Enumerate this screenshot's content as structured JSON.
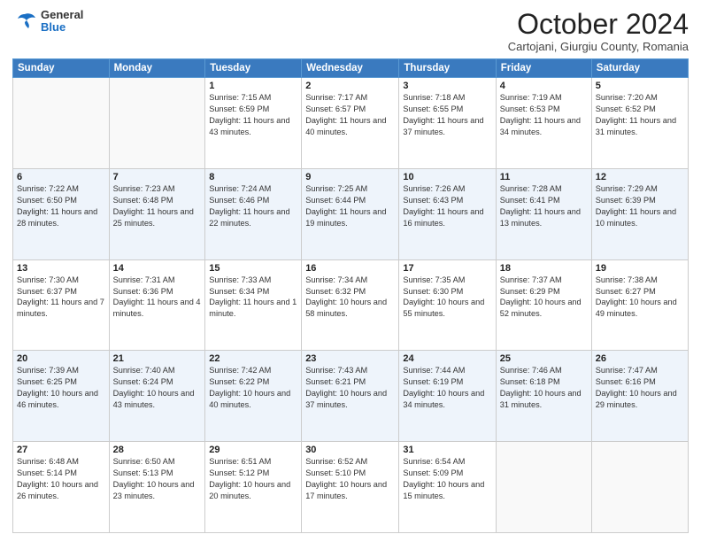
{
  "header": {
    "logo": {
      "general": "General",
      "blue": "Blue"
    },
    "title": "October 2024",
    "subtitle": "Cartojani, Giurgiu County, Romania"
  },
  "days_of_week": [
    "Sunday",
    "Monday",
    "Tuesday",
    "Wednesday",
    "Thursday",
    "Friday",
    "Saturday"
  ],
  "weeks": [
    [
      {
        "day": "",
        "info": ""
      },
      {
        "day": "",
        "info": ""
      },
      {
        "day": "1",
        "info": "Sunrise: 7:15 AM\nSunset: 6:59 PM\nDaylight: 11 hours and 43 minutes."
      },
      {
        "day": "2",
        "info": "Sunrise: 7:17 AM\nSunset: 6:57 PM\nDaylight: 11 hours and 40 minutes."
      },
      {
        "day": "3",
        "info": "Sunrise: 7:18 AM\nSunset: 6:55 PM\nDaylight: 11 hours and 37 minutes."
      },
      {
        "day": "4",
        "info": "Sunrise: 7:19 AM\nSunset: 6:53 PM\nDaylight: 11 hours and 34 minutes."
      },
      {
        "day": "5",
        "info": "Sunrise: 7:20 AM\nSunset: 6:52 PM\nDaylight: 11 hours and 31 minutes."
      }
    ],
    [
      {
        "day": "6",
        "info": "Sunrise: 7:22 AM\nSunset: 6:50 PM\nDaylight: 11 hours and 28 minutes."
      },
      {
        "day": "7",
        "info": "Sunrise: 7:23 AM\nSunset: 6:48 PM\nDaylight: 11 hours and 25 minutes."
      },
      {
        "day": "8",
        "info": "Sunrise: 7:24 AM\nSunset: 6:46 PM\nDaylight: 11 hours and 22 minutes."
      },
      {
        "day": "9",
        "info": "Sunrise: 7:25 AM\nSunset: 6:44 PM\nDaylight: 11 hours and 19 minutes."
      },
      {
        "day": "10",
        "info": "Sunrise: 7:26 AM\nSunset: 6:43 PM\nDaylight: 11 hours and 16 minutes."
      },
      {
        "day": "11",
        "info": "Sunrise: 7:28 AM\nSunset: 6:41 PM\nDaylight: 11 hours and 13 minutes."
      },
      {
        "day": "12",
        "info": "Sunrise: 7:29 AM\nSunset: 6:39 PM\nDaylight: 11 hours and 10 minutes."
      }
    ],
    [
      {
        "day": "13",
        "info": "Sunrise: 7:30 AM\nSunset: 6:37 PM\nDaylight: 11 hours and 7 minutes."
      },
      {
        "day": "14",
        "info": "Sunrise: 7:31 AM\nSunset: 6:36 PM\nDaylight: 11 hours and 4 minutes."
      },
      {
        "day": "15",
        "info": "Sunrise: 7:33 AM\nSunset: 6:34 PM\nDaylight: 11 hours and 1 minute."
      },
      {
        "day": "16",
        "info": "Sunrise: 7:34 AM\nSunset: 6:32 PM\nDaylight: 10 hours and 58 minutes."
      },
      {
        "day": "17",
        "info": "Sunrise: 7:35 AM\nSunset: 6:30 PM\nDaylight: 10 hours and 55 minutes."
      },
      {
        "day": "18",
        "info": "Sunrise: 7:37 AM\nSunset: 6:29 PM\nDaylight: 10 hours and 52 minutes."
      },
      {
        "day": "19",
        "info": "Sunrise: 7:38 AM\nSunset: 6:27 PM\nDaylight: 10 hours and 49 minutes."
      }
    ],
    [
      {
        "day": "20",
        "info": "Sunrise: 7:39 AM\nSunset: 6:25 PM\nDaylight: 10 hours and 46 minutes."
      },
      {
        "day": "21",
        "info": "Sunrise: 7:40 AM\nSunset: 6:24 PM\nDaylight: 10 hours and 43 minutes."
      },
      {
        "day": "22",
        "info": "Sunrise: 7:42 AM\nSunset: 6:22 PM\nDaylight: 10 hours and 40 minutes."
      },
      {
        "day": "23",
        "info": "Sunrise: 7:43 AM\nSunset: 6:21 PM\nDaylight: 10 hours and 37 minutes."
      },
      {
        "day": "24",
        "info": "Sunrise: 7:44 AM\nSunset: 6:19 PM\nDaylight: 10 hours and 34 minutes."
      },
      {
        "day": "25",
        "info": "Sunrise: 7:46 AM\nSunset: 6:18 PM\nDaylight: 10 hours and 31 minutes."
      },
      {
        "day": "26",
        "info": "Sunrise: 7:47 AM\nSunset: 6:16 PM\nDaylight: 10 hours and 29 minutes."
      }
    ],
    [
      {
        "day": "27",
        "info": "Sunrise: 6:48 AM\nSunset: 5:14 PM\nDaylight: 10 hours and 26 minutes."
      },
      {
        "day": "28",
        "info": "Sunrise: 6:50 AM\nSunset: 5:13 PM\nDaylight: 10 hours and 23 minutes."
      },
      {
        "day": "29",
        "info": "Sunrise: 6:51 AM\nSunset: 5:12 PM\nDaylight: 10 hours and 20 minutes."
      },
      {
        "day": "30",
        "info": "Sunrise: 6:52 AM\nSunset: 5:10 PM\nDaylight: 10 hours and 17 minutes."
      },
      {
        "day": "31",
        "info": "Sunrise: 6:54 AM\nSunset: 5:09 PM\nDaylight: 10 hours and 15 minutes."
      },
      {
        "day": "",
        "info": ""
      },
      {
        "day": "",
        "info": ""
      }
    ]
  ]
}
